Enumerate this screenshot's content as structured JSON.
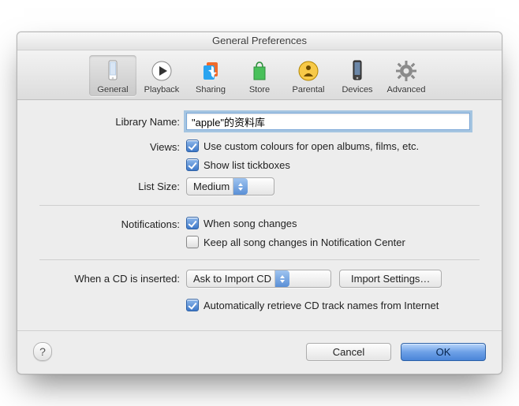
{
  "window_title": "General Preferences",
  "toolbar": {
    "items": [
      {
        "id": "general",
        "label": "General",
        "selected": true
      },
      {
        "id": "playback",
        "label": "Playback",
        "selected": false
      },
      {
        "id": "sharing",
        "label": "Sharing",
        "selected": false
      },
      {
        "id": "store",
        "label": "Store",
        "selected": false
      },
      {
        "id": "parental",
        "label": "Parental",
        "selected": false
      },
      {
        "id": "devices",
        "label": "Devices",
        "selected": false
      },
      {
        "id": "advanced",
        "label": "Advanced",
        "selected": false
      }
    ]
  },
  "labels": {
    "library_name": "Library Name:",
    "views": "Views:",
    "list_size": "List Size:",
    "notifications": "Notifications:",
    "cd_inserted": "When a CD is inserted:"
  },
  "fields": {
    "library_name_value": "\"apple\"的资料库",
    "views_custom_colors": {
      "checked": true,
      "label": "Use custom colours for open albums, films, etc."
    },
    "views_show_tickboxes": {
      "checked": true,
      "label": "Show list tickboxes"
    },
    "list_size_value": "Medium",
    "notif_song_changes": {
      "checked": true,
      "label": "When song changes"
    },
    "notif_keep_center": {
      "checked": false,
      "label": "Keep all song changes in Notification Center"
    },
    "cd_action_value": "Ask to Import CD",
    "import_settings_btn": "Import Settings…",
    "auto_retrieve": {
      "checked": true,
      "label": "Automatically retrieve CD track names from Internet"
    }
  },
  "buttons": {
    "cancel": "Cancel",
    "ok": "OK"
  },
  "icons": {
    "general": "phone",
    "playback": "play",
    "sharing": "music-note",
    "store": "bag",
    "parental": "person-warning",
    "devices": "device",
    "advanced": "gear",
    "help": "?"
  }
}
